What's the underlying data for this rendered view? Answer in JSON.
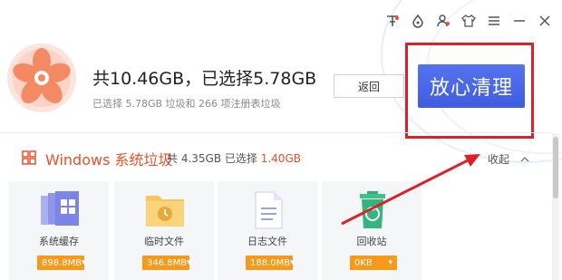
{
  "window_controls": [
    {
      "name": "skin-icon"
    },
    {
      "name": "drop-icon"
    },
    {
      "name": "user-icon"
    },
    {
      "name": "shirt-icon"
    },
    {
      "name": "menu-icon"
    },
    {
      "name": "minimize-icon"
    },
    {
      "name": "close-icon"
    }
  ],
  "header": {
    "title": "共10.46GB，已选择5.78GB",
    "subtitle": "已选择 5.78GB 垃圾和 266 项注册表垃圾",
    "back_label": "返回",
    "clean_label": "放心清理"
  },
  "section": {
    "title": "Windows 系统垃圾",
    "stats_prefix": "共 4.35GB 已选择",
    "stats_selected": "1.40GB",
    "collapse_label": "收起"
  },
  "cards": [
    {
      "label": "系统缓存",
      "size": "898.8MB",
      "icon": "windows-cache-icon"
    },
    {
      "label": "临时文件",
      "size": "346.8MB",
      "icon": "temp-folder-icon"
    },
    {
      "label": "日志文件",
      "size": "188.0MB",
      "icon": "log-file-icon"
    },
    {
      "label": "回收站",
      "size": "0KB",
      "icon": "recycle-bin-icon"
    }
  ],
  "colors": {
    "accent": "#e6512a",
    "button_blue": "#4a66e8",
    "badge_orange": "#f79a1c",
    "annotation_red": "#d8232a"
  }
}
